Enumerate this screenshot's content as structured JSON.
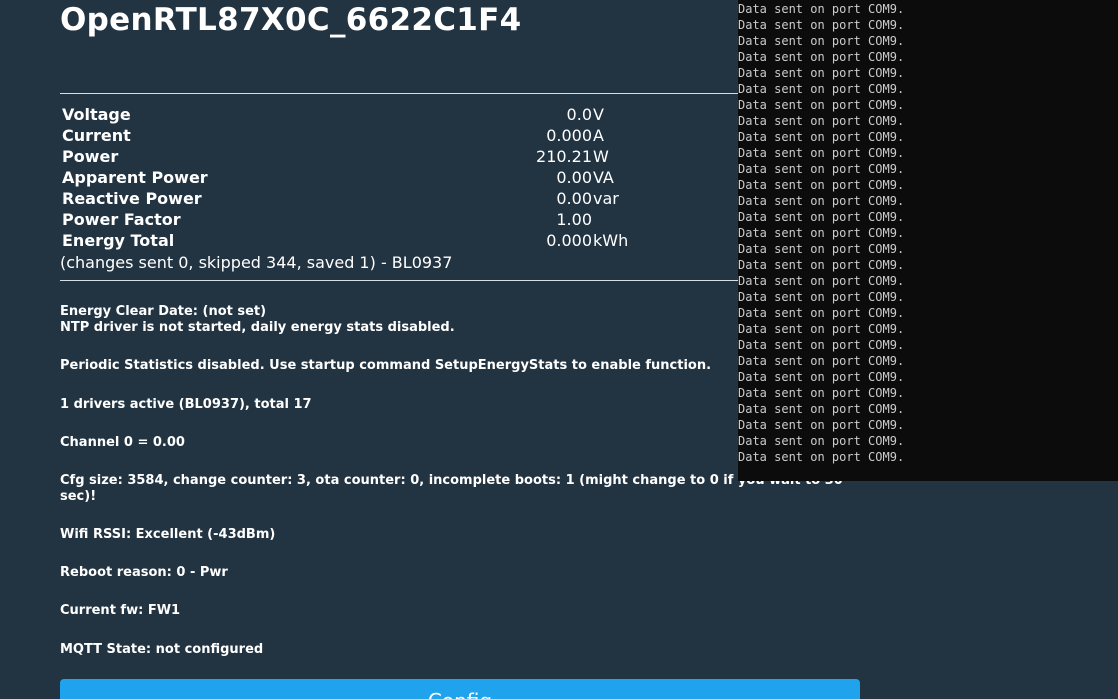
{
  "device": {
    "title": "OpenRTL87X0C_6622C1F4"
  },
  "measurements": [
    {
      "label": "Voltage",
      "value": "0.0",
      "unit": "V"
    },
    {
      "label": "Current",
      "value": "0.000",
      "unit": "A"
    },
    {
      "label": "Power",
      "value": "210.21",
      "unit": "W"
    },
    {
      "label": "Apparent Power",
      "value": "0.00",
      "unit": "VA"
    },
    {
      "label": "Reactive Power",
      "value": "0.00",
      "unit": "var"
    },
    {
      "label": "Power Factor",
      "value": "1.00",
      "unit": ""
    },
    {
      "label": "Energy Total",
      "value": "0.000",
      "unit": "kWh"
    }
  ],
  "measurement_summary": "(changes sent 0, skipped 344, saved 1) - BL0937",
  "info": {
    "energy_clear_date": "Energy Clear Date: (not set)",
    "ntp_status": "NTP driver is not started, daily energy stats disabled.",
    "periodic_stats": "Periodic Statistics disabled. Use startup command SetupEnergyStats to enable function.",
    "drivers": "1 drivers active (BL0937), total 17",
    "channel": "Channel 0 = 0.00",
    "cfg": "Cfg size: 3584, change counter: 3, ota counter: 0, incomplete boots: 1 (might change to 0 if you wait to 30 sec)!",
    "wifi": "Wifi RSSI: Excellent (-43dBm)",
    "reboot": "Reboot reason: 0 - Pwr",
    "firmware": "Current fw: FW1",
    "mqtt": "MQTT State: not configured"
  },
  "buttons": {
    "config_label": "Config"
  },
  "console": {
    "lines": [
      "Data sent on port COM9.",
      "Data sent on port COM9.",
      "Data sent on port COM9.",
      "Data sent on port COM9.",
      "Data sent on port COM9.",
      "Data sent on port COM9.",
      "Data sent on port COM9.",
      "Data sent on port COM9.",
      "Data sent on port COM9.",
      "Data sent on port COM9.",
      "Data sent on port COM9.",
      "Data sent on port COM9.",
      "Data sent on port COM9.",
      "Data sent on port COM9.",
      "Data sent on port COM9.",
      "Data sent on port COM9.",
      "Data sent on port COM9.",
      "Data sent on port COM9.",
      "Data sent on port COM9.",
      "Data sent on port COM9.",
      "Data sent on port COM9.",
      "Data sent on port COM9.",
      "Data sent on port COM9.",
      "Data sent on port COM9.",
      "Data sent on port COM9.",
      "Data sent on port COM9.",
      "Data sent on port COM9.",
      "Data sent on port COM9.",
      "Data sent on port COM9."
    ]
  },
  "colors": {
    "page_background": "#223341",
    "button_accent": "#1fa3ec",
    "console_background": "#0c0c0c",
    "console_text": "#cccccc"
  }
}
